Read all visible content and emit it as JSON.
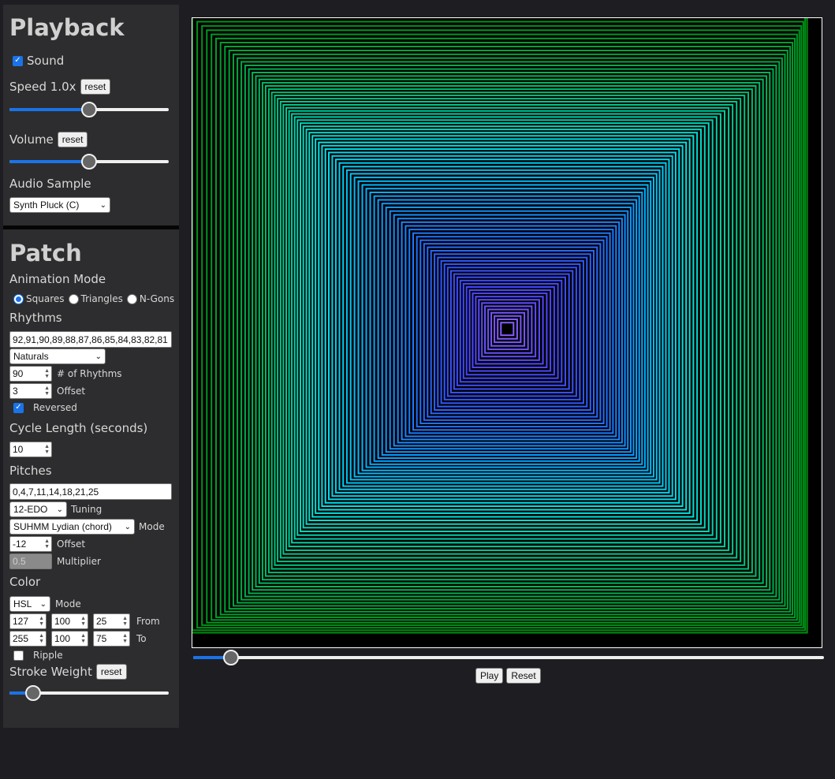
{
  "playback": {
    "title": "Playback",
    "sound_label": "Sound",
    "sound_checked": true,
    "speed_label": "Speed 1.0x",
    "speed_reset": "reset",
    "speed_value": 0.5,
    "volume_label": "Volume",
    "volume_reset": "reset",
    "volume_value": 0.5,
    "audio_sample_label": "Audio Sample",
    "audio_sample_value": "Synth Pluck (C)"
  },
  "patch": {
    "title": "Patch",
    "animation_mode_label": "Animation Mode",
    "modes": [
      {
        "label": "Squares",
        "selected": true
      },
      {
        "label": "Triangles",
        "selected": false
      },
      {
        "label": "N-Gons",
        "selected": false
      }
    ],
    "rhythms_label": "Rhythms",
    "rhythms_value": "92,91,90,89,88,87,86,85,84,83,82,81",
    "rhythm_preset": "Naturals",
    "num_rhythms_value": "90",
    "num_rhythms_label": "# of Rhythms",
    "rhythm_offset_value": "3",
    "rhythm_offset_label": "Offset",
    "reversed_label": "Reversed",
    "reversed_checked": true,
    "cycle_length_label": "Cycle Length (seconds)",
    "cycle_length_value": "10",
    "pitches_label": "Pitches",
    "pitches_value": "0,4,7,11,14,18,21,25",
    "tuning_value": "12-EDO",
    "tuning_label": "Tuning",
    "mode_value": "SUHMM Lydian (chord)",
    "mode_label": "Mode",
    "pitch_offset_value": "-12",
    "pitch_offset_label": "Offset",
    "multiplier_value": "0.5",
    "multiplier_label": "Multiplier",
    "color_label": "Color",
    "color_mode_value": "HSL",
    "color_mode_label": "Mode",
    "from_values": [
      "127",
      "100",
      "25"
    ],
    "from_label": "From",
    "to_values": [
      "255",
      "100",
      "75"
    ],
    "to_label": "To",
    "ripple_label": "Ripple",
    "ripple_checked": false,
    "stroke_weight_label": "Stroke Weight",
    "stroke_weight_reset": "reset",
    "stroke_weight_value": 0.15
  },
  "visualization": {
    "shape": "squares",
    "count": 90,
    "hue_from": 127,
    "hue_to": 255
  },
  "timeline": {
    "position": 0.06
  },
  "controls": {
    "play_label": "Play",
    "reset_label": "Reset"
  }
}
